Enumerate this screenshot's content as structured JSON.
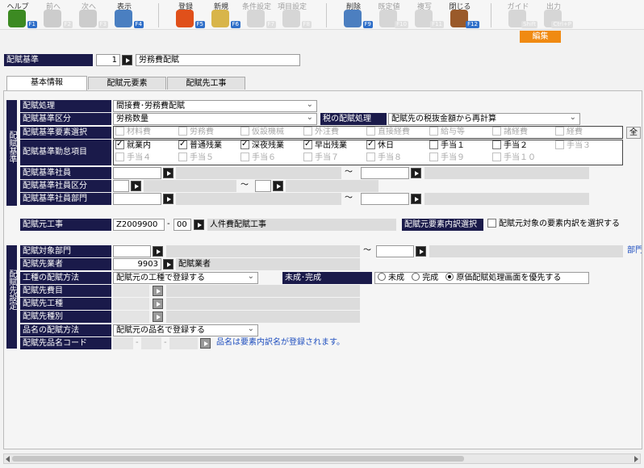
{
  "toolbar": {
    "items": [
      {
        "label": "ヘルプ",
        "fkey": "F1",
        "icon": "help-icon",
        "color": "#3c8a22"
      },
      {
        "label": "前へ",
        "fkey": "F2",
        "icon": "prev-icon",
        "color": "#9a9a9a"
      },
      {
        "label": "次へ",
        "fkey": "F3",
        "icon": "next-icon",
        "color": "#9a9a9a"
      },
      {
        "label": "表示",
        "fkey": "F4",
        "icon": "search-icon",
        "color": "#4a7fc1"
      },
      {
        "label": "登録",
        "fkey": "F5",
        "icon": "ok-icon",
        "color": "#e0501a"
      },
      {
        "label": "新規",
        "fkey": "F6",
        "icon": "new-doc-icon",
        "color": "#d8b54a"
      },
      {
        "label": "条件設定",
        "fkey": "F7",
        "icon": "condition-icon",
        "color": "#b0b0b0"
      },
      {
        "label": "項目設定",
        "fkey": "F8",
        "icon": "item-settings-icon",
        "color": "#b0b0b0"
      },
      {
        "label": "削除",
        "fkey": "F9",
        "icon": "trash-icon",
        "color": "#4c7fc0"
      },
      {
        "label": "既定値",
        "fkey": "F10",
        "icon": "default-icon",
        "color": "#b0b0b0"
      },
      {
        "label": "複写",
        "fkey": "F11",
        "icon": "copy-icon",
        "color": "#b0b0b0"
      },
      {
        "label": "閉じる",
        "fkey": "F12",
        "icon": "door-icon",
        "color": "#9a5a2a"
      },
      {
        "label": "ガイド",
        "fkey": "Shift",
        "icon": "guide-icon",
        "color": "#b0b0b0"
      },
      {
        "label": "出力",
        "fkey": "Ctrl+P",
        "icon": "print-icon",
        "color": "#b0b0b0"
      }
    ],
    "edit_badge": "編集"
  },
  "header": {
    "label": "配賦基準",
    "code": "1",
    "name": "労務費配賦"
  },
  "tabs": [
    "基本情報",
    "配賦元要素",
    "配賦先工事"
  ],
  "kijun": {
    "section_label": "配賦基準",
    "shori_label": "配賦処理",
    "shori_value": "間接費･労務費配賦",
    "kubun_label": "配賦基準区分",
    "kubun_value": "労務数量",
    "zei_label": "税の配賦処理",
    "zei_value": "配賦先の税抜金額から再計算",
    "youso_label": "配賦基準要素選択",
    "youso_items": [
      "材料費",
      "労務費",
      "仮設機械",
      "外注費",
      "直接経費",
      "給与等",
      "諸経費",
      "経費"
    ],
    "all_button": "全",
    "kinmu_label": "配賦基準勤怠項目",
    "kinmu_row1": [
      "就業内",
      "普通残業",
      "深夜残業",
      "早出残業",
      "休日",
      "手当１",
      "手当２",
      "手当３"
    ],
    "kinmu_row2": [
      "手当４",
      "手当５",
      "手当６",
      "手当７",
      "手当８",
      "手当９",
      "手当１０"
    ],
    "shain_label": "配賦基準社員",
    "shain_kubun_label": "配賦基準社員区分",
    "shain_bumon_label": "配賦基準社員部門",
    "tilde": "～"
  },
  "moto": {
    "label": "配賦元工事",
    "code": "Z2009900",
    "sub": "00",
    "name": "人件費配賦工事",
    "uchiwake_label": "配賦元要素内訳選択",
    "uchiwake_check": "配賦元対象の要素内訳を選択する"
  },
  "saki": {
    "section_label": "配賦先設定",
    "bumon_label": "配賦対象部門",
    "bumon_suffix": "部門",
    "gyousha_label": "配賦先業者",
    "gyousha_code": "9903",
    "gyousha_name": "配賦業者",
    "koushu_label": "工種の配賦方法",
    "koushu_value": "配賦元の工種で登録する",
    "mikansei_label": "未成･完成",
    "radio_options": [
      "未成",
      "完成",
      "原価配賦処理画面を優先する"
    ],
    "hiyou_label": "配賦先費目",
    "koushu2_label": "配賦先工種",
    "shubetsu_label": "配賦先種別",
    "hinmei_label": "品名の配賦方法",
    "hinmei_value": "配賦元の品名で登録する",
    "hinmei_code_label": "配賦先品名コード",
    "hinmei_note": "品名は要素内訳名が登録されます。"
  }
}
